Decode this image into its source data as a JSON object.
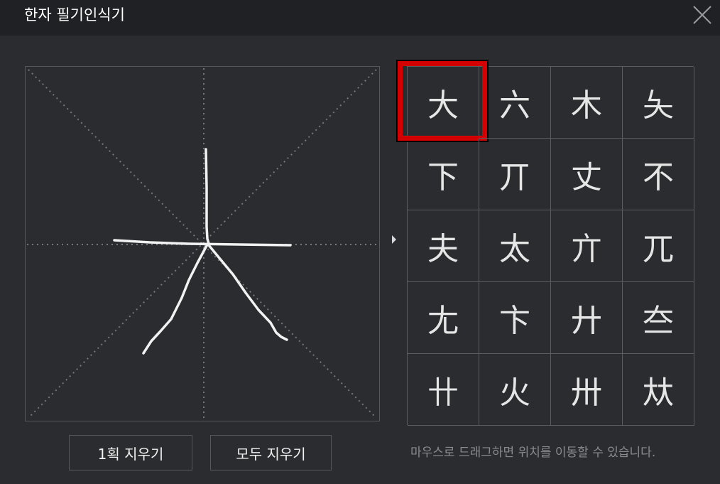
{
  "title": "한자 필기인식기",
  "close_icon": "close-icon",
  "candidates": [
    "大",
    "六",
    "木",
    "夨",
    "下",
    "丌",
    "丈",
    "不",
    "夫",
    "太",
    "亣",
    "兀",
    "尢",
    "卞",
    "廾",
    "夳",
    "卄",
    "火",
    "卅",
    "夶"
  ],
  "selected_index": 0,
  "buttons": {
    "undo_stroke_label": "1획 지우기",
    "clear_all_label": "모두 지우기"
  },
  "hint": "마우스로 드래그하면 위치를 이동할 수 있습니다.",
  "colors": {
    "background": "#2b2c2f",
    "titlebar": "#202124",
    "selection": "#d40000"
  }
}
